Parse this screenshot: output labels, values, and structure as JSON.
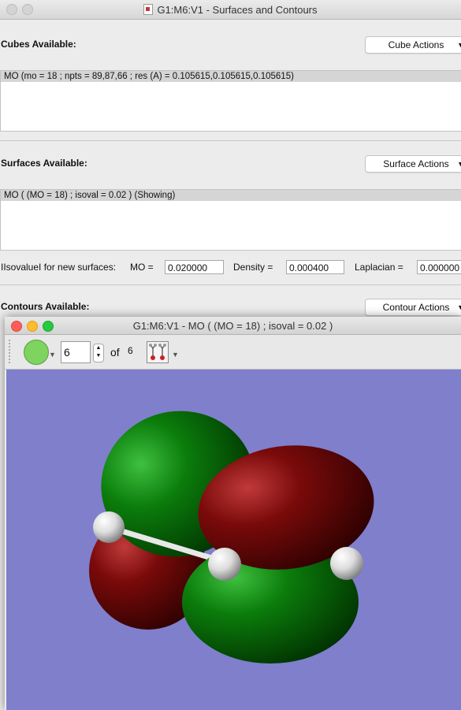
{
  "back_window": {
    "title": "G1:M6:V1 - Surfaces and Contours",
    "cubes": {
      "label": "Cubes Available:",
      "action_label": "Cube Actions",
      "items": [
        "MO (mo = 18 ; npts = 89,87,66 ; res (A) = 0.105615,0.105615,0.105615)"
      ]
    },
    "surfaces": {
      "label": "Surfaces Available:",
      "action_label": "Surface Actions",
      "items": [
        "MO ( (MO = 18) ; isoval = 0.02 ) (Showing)"
      ]
    },
    "isovalue": {
      "label": "IIsovalueI for new surfaces:",
      "mo_label": "MO =",
      "mo_value": "0.020000",
      "density_label": "Density =",
      "density_value": "0.000400",
      "laplacian_label": "Laplacian =",
      "laplacian_value": "0.000000"
    },
    "contours": {
      "label": "Contours Available:",
      "action_label": "Contour Actions"
    }
  },
  "front_window": {
    "title": "G1:M6:V1 - MO ( (MO = 18) ; isoval = 0.02 )",
    "toolbar": {
      "color_swatch": "#7fd35f",
      "index_value": "6",
      "of_label": "of",
      "total": "6",
      "icon": "molecule-select-icon"
    },
    "viewer": {
      "background": "#7f7fcc",
      "lobe_colors": {
        "positive": "#0a7a0a",
        "negative": "#7c0a0a"
      },
      "atoms": "white-hydrogen-spheres"
    }
  }
}
